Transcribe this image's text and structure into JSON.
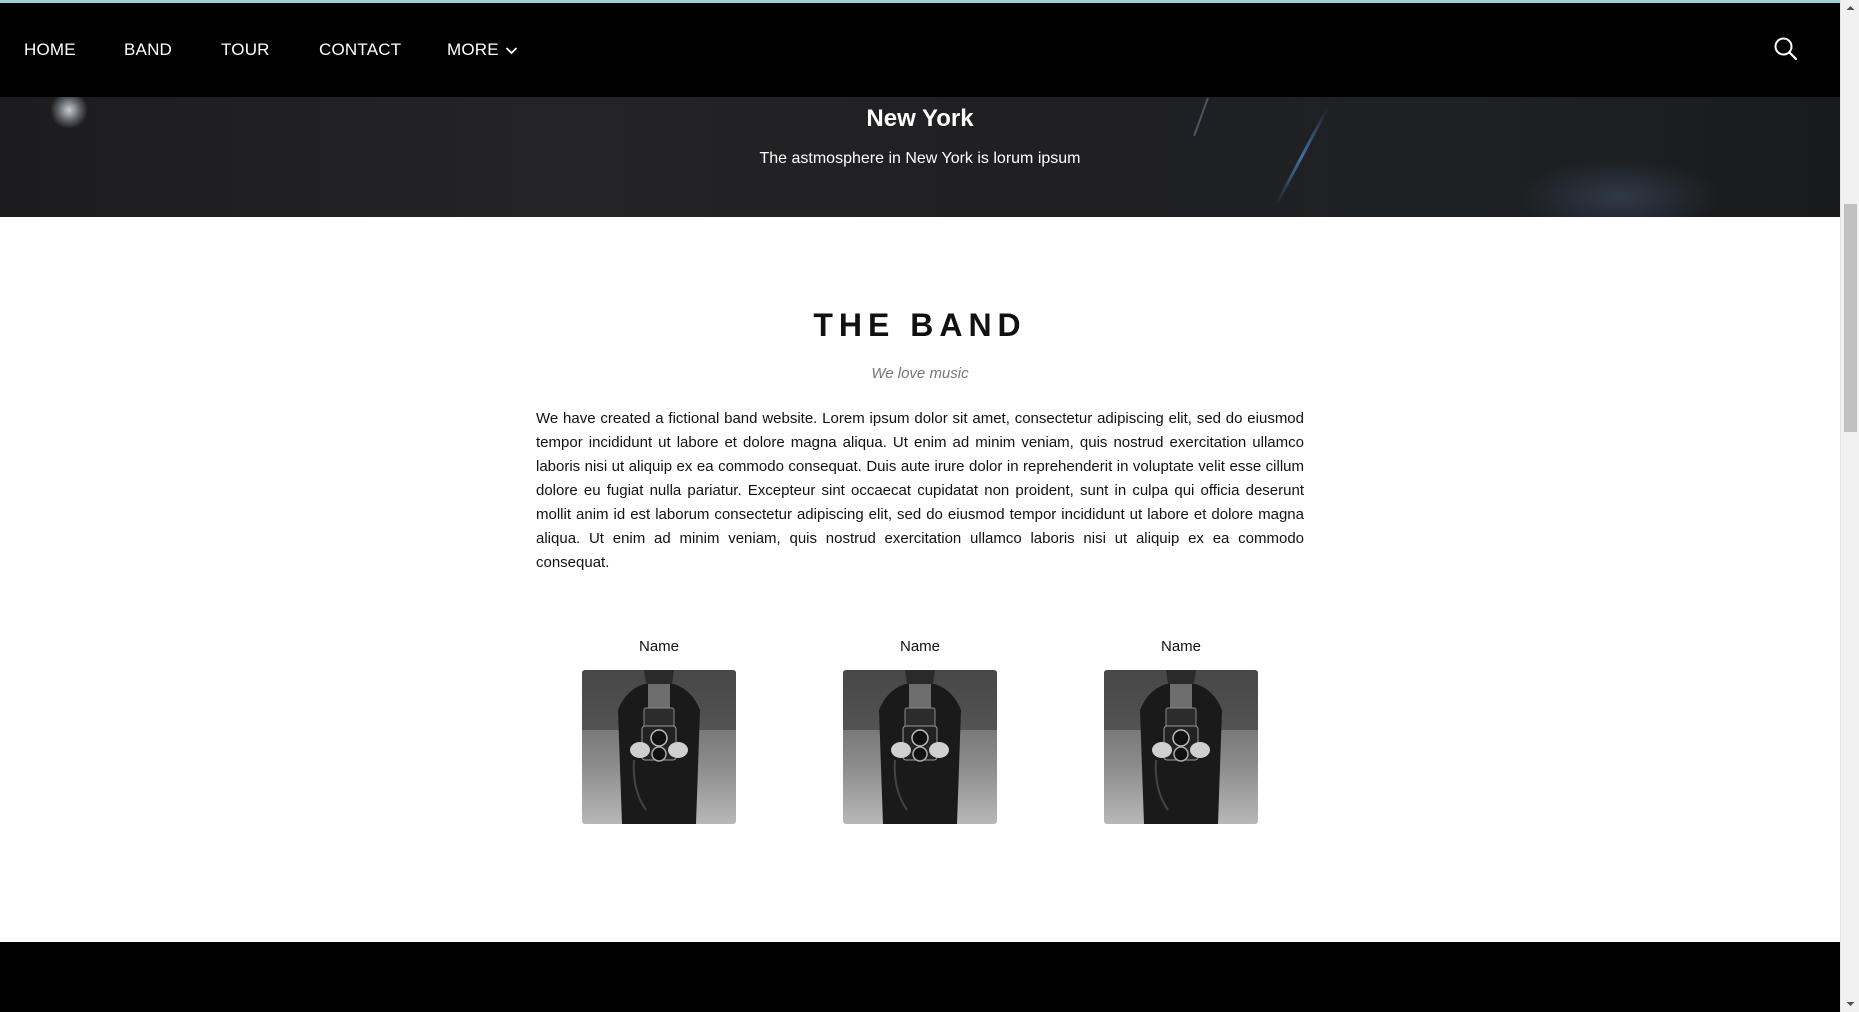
{
  "nav": {
    "items": [
      {
        "label": "HOME"
      },
      {
        "label": "BAND"
      },
      {
        "label": "TOUR"
      },
      {
        "label": "CONTACT"
      },
      {
        "label": "MORE"
      }
    ],
    "search_icon": "search-icon",
    "more_icon": "chevron-down-icon"
  },
  "hero": {
    "title": "New York",
    "subtitle": "The astmosphere in New York is lorum ipsum"
  },
  "band": {
    "title": "THE BAND",
    "tagline": "We love music",
    "description": "We have created a fictional band website. Lorem ipsum dolor sit amet, consectetur adipiscing elit, sed do eiusmod tempor incididunt ut labore et dolore magna aliqua. Ut enim ad minim veniam, quis nostrud exercitation ullamco laboris nisi ut aliquip ex ea commodo consequat. Duis aute irure dolor in reprehenderit in voluptate velit esse cillum dolore eu fugiat nulla pariatur. Excepteur sint occaecat cupidatat non proident, sunt in culpa qui officia deserunt mollit anim id est laborum consectetur adipiscing elit, sed do eiusmod tempor incididunt ut labore et dolore magna aliqua. Ut enim ad minim veniam, quis nostrud exercitation ullamco laboris nisi ut aliquip ex ea commodo consequat.",
    "members": [
      {
        "name": "Name"
      },
      {
        "name": "Name"
      },
      {
        "name": "Name"
      }
    ]
  },
  "colors": {
    "navbar_bg": "#000000",
    "accent_line": "#9ccfd8",
    "footer_bg": "#000000",
    "tagline": "#777777"
  }
}
